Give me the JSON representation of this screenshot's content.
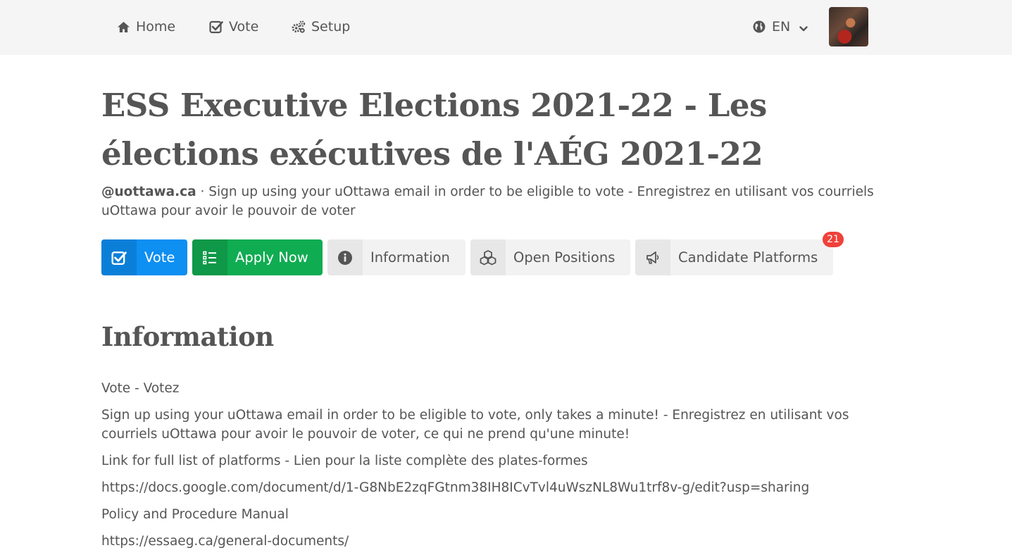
{
  "nav": {
    "home_label": "Home",
    "vote_label": "Vote",
    "setup_label": "Setup",
    "lang_label": "EN"
  },
  "election": {
    "title": "ESS Executive Elections 2021-22 - Les élections exécutives de l'AÉG 2021-22",
    "domain": "@uottawa.ca",
    "separator": " · ",
    "subtitle": "Sign up using your uOttawa email in order to be eligible to vote - Enregistrez en utilisant vos courriels uOttawa pour avoir le pouvoir de voter"
  },
  "actions": {
    "vote_label": "Vote",
    "apply_label": "Apply Now",
    "information_label": "Information",
    "open_positions_label": "Open Positions",
    "candidate_platforms_label": "Candidate Platforms",
    "candidate_platforms_count": "21"
  },
  "information": {
    "heading": "Information",
    "lines": [
      "Vote - Votez",
      "Sign up using your uOttawa email in order to be eligible to vote, only takes a minute! - Enregistrez en utilisant vos courriels uOttawa pour avoir le pouvoir de voter, ce qui ne prend qu'une minute!",
      "Link for full list of platforms - Lien pour la liste complète des plates-formes",
      "https://docs.google.com/document/d/1-G8NbE2zqFGtnm38IH8ICvTvl4uWszNL8Wu1trf8v-g/edit?usp=sharing",
      "Policy and Procedure Manual",
      "https://essaeg.ca/general-documents/"
    ]
  },
  "colors": {
    "vote_button": "#0e8ff2",
    "apply_button": "#10ac52",
    "badge": "#f0413a",
    "navbar_bg": "#f5f5f6"
  },
  "icons": {
    "home": "home-icon",
    "vote": "check-square-icon",
    "setup": "gears-icon",
    "language": "globe-icon",
    "dropdown": "chevron-down-icon",
    "apply": "list-icon",
    "information": "info-circle-icon",
    "open_positions": "cubes-icon",
    "candidate_platforms": "megaphone-icon"
  }
}
